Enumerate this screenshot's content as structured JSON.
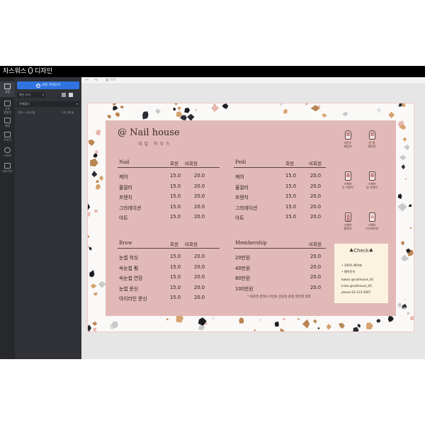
{
  "app": {
    "title": "차스워스",
    "subtitle": "디자인"
  },
  "rail": {
    "items": [
      {
        "label": "사진"
      },
      {
        "label": "기본\n템플릿"
      },
      {
        "label": "배경"
      },
      {
        "label": "꾸미기"
      },
      {
        "label": "스티커"
      },
      {
        "label": "내디자인"
      }
    ]
  },
  "panel": {
    "upload_label": "사진 가져오기",
    "sort_label": "최신 순서",
    "folder_label": "전체폴더",
    "breadcrumb": "전체 > 내사진함",
    "count": "0개 선택 됨"
  },
  "toolbar": {
    "undo": "↶",
    "redo": "↷",
    "layout_label": "격자"
  },
  "menu": {
    "title": "@ Nail house",
    "subtitle": "네일 하우스",
    "nail": {
      "header": "Nail",
      "member_col": "회원",
      "nonmember_col": "비회원",
      "rows": [
        {
          "name": "케어",
          "member": "15.0",
          "nonmember": "20.0"
        },
        {
          "name": "풀컬러",
          "member": "15.0",
          "nonmember": "20.0"
        },
        {
          "name": "프렌치",
          "member": "15.0",
          "nonmember": "20.0"
        },
        {
          "name": "그라데이션",
          "member": "15.0",
          "nonmember": "20.0"
        },
        {
          "name": "아트",
          "member": "15.0",
          "nonmember": "20.0"
        }
      ]
    },
    "pedi": {
      "header": "Pedi",
      "member_col": "회원",
      "nonmember_col": "비회원",
      "rows": [
        {
          "name": "케어",
          "member": "15.0",
          "nonmember": "20.0"
        },
        {
          "name": "풀컬러",
          "member": "15.0",
          "nonmember": "20.0"
        },
        {
          "name": "프렌치",
          "member": "15.0",
          "nonmember": "20.0"
        },
        {
          "name": "그라데이션",
          "member": "15.0",
          "nonmember": "20.0"
        },
        {
          "name": "아트",
          "member": "15.0",
          "nonmember": "20.0"
        }
      ]
    },
    "brow": {
      "header": "Brow",
      "member_col": "회원",
      "nonmember_col": "비회원",
      "rows": [
        {
          "name": "눈썹 왁싱",
          "member": "15.0",
          "nonmember": "20.0"
        },
        {
          "name": "속눈썹 펌",
          "member": "15.0",
          "nonmember": "20.0"
        },
        {
          "name": "속눈썹 연장",
          "member": "15.0",
          "nonmember": "20.0"
        },
        {
          "name": "눈썹 문신",
          "member": "15.0",
          "nonmember": "20.0"
        },
        {
          "name": "아이라인 문신",
          "member": "15.0",
          "nonmember": "20.0"
        }
      ]
    },
    "membership": {
      "header": "Membership",
      "nonmember_col": "비회원",
      "rows": [
        {
          "name": "20만원",
          "nonmember": "20.0"
        },
        {
          "name": "40만원",
          "nonmember": "20.0"
        },
        {
          "name": "80만원",
          "nonmember": "20.0"
        },
        {
          "name": "100만원",
          "nonmember": "20.0"
        }
      ]
    },
    "note": "* 회원권 결제시 5만원 상당의 손톱 영양제 증정",
    "nail_icons": [
      {
        "label": "라운드\n쉐입의"
      },
      {
        "label": "반 원\n쉐입의"
      },
      {
        "label": "스퀘어\n손 프렌치"
      },
      {
        "label": "스퀘어\n딥 프렌치"
      },
      {
        "label": "스퀘어\n풀컬러"
      },
      {
        "label": "스퀘어\n그라데이션"
      }
    ],
    "check": {
      "title": "♣Check♣",
      "lines": [
        "• 100% 예약제",
        "• 예약문의",
        "kakao @nailhouse_81",
        "insta @nailhouse_81",
        "phone 02-123-4567"
      ]
    }
  },
  "colors": {
    "card_pink": "#e1b9b6",
    "check_bg": "#fbf3df",
    "accent_blue": "#2f74e0"
  }
}
